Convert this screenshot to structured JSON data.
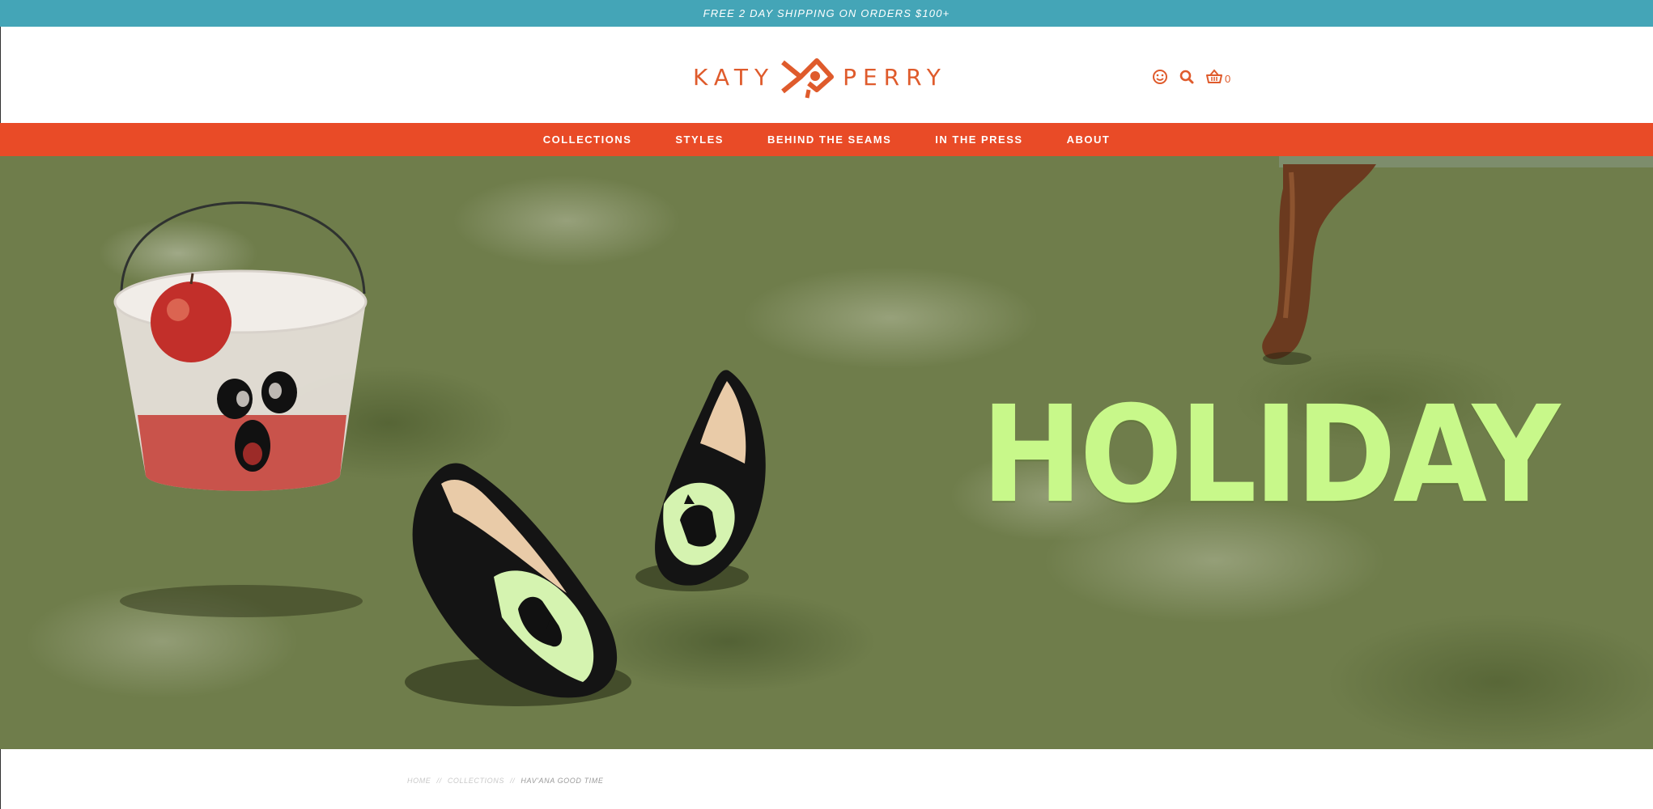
{
  "announcement": {
    "text": "FREE 2 DAY SHIPPING ON ORDERS $100+"
  },
  "brand": {
    "name_left": "KATY",
    "name_right": "PERRY",
    "accent_color": "#df5b2c"
  },
  "header_icons": {
    "account": "smiley-account-icon",
    "search": "search-icon",
    "cart": "basket-cart-icon",
    "cart_count": "0"
  },
  "nav": {
    "items": [
      {
        "label": "COLLECTIONS"
      },
      {
        "label": "STYLES"
      },
      {
        "label": "BEHIND THE SEAMS"
      },
      {
        "label": "IN THE PRESS"
      },
      {
        "label": "ABOUT"
      }
    ],
    "background": "#e94b27"
  },
  "hero": {
    "headline": "HOLIDAY",
    "headline_color": "#c8f88a",
    "scene": [
      "ghost-bucket-with-apples",
      "black-cat-loafers",
      "armchair-leg",
      "green-shag-carpet"
    ]
  },
  "breadcrumb": {
    "home": "HOME",
    "collections": "COLLECTIONS",
    "current": "HAV'ANA GOOD TIME",
    "separator": "//"
  }
}
